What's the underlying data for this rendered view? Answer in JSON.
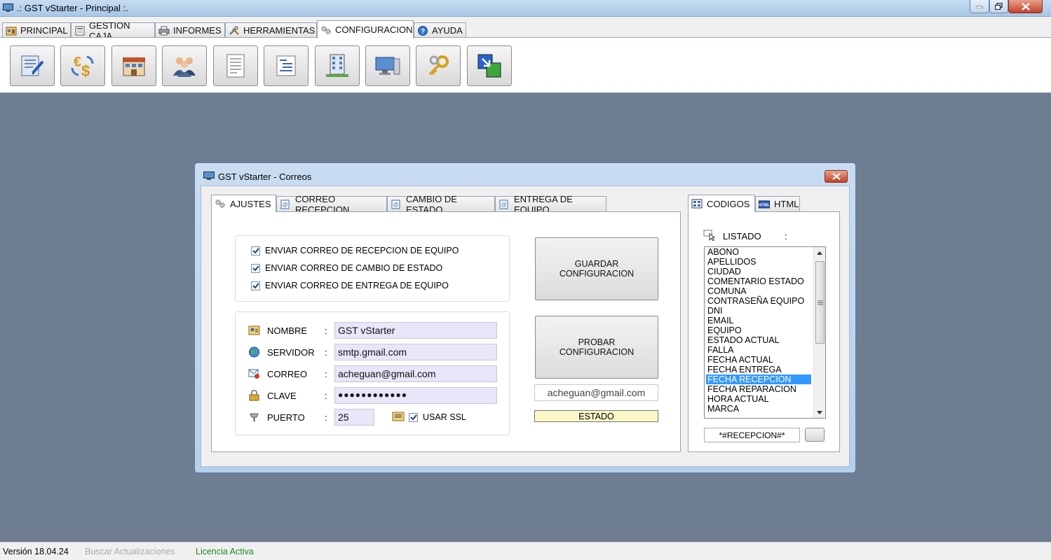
{
  "window": {
    "title": ".: GST vStarter - Principal :."
  },
  "main_tabs": [
    {
      "label": "PRINCIPAL",
      "icon": "home-icon"
    },
    {
      "label": "GESTION CAJA",
      "icon": "cash-register-icon"
    },
    {
      "label": "INFORMES",
      "icon": "printer-icon"
    },
    {
      "label": "HERRAMIENTAS",
      "icon": "tools-icon"
    },
    {
      "label": "CONFIGURACION",
      "icon": "gears-icon",
      "active": true
    },
    {
      "label": "AYUDA",
      "icon": "help-icon"
    }
  ],
  "toolbar": {
    "buttons": [
      {
        "icon": "edit-form-icon"
      },
      {
        "icon": "currency-exchange-icon"
      },
      {
        "icon": "store-icon"
      },
      {
        "icon": "users-icon"
      },
      {
        "icon": "document-icon"
      },
      {
        "icon": "text-list-icon"
      },
      {
        "icon": "building-icon"
      },
      {
        "icon": "computer-icon"
      },
      {
        "icon": "keys-icon"
      },
      {
        "icon": "shortcut-icon"
      }
    ]
  },
  "dialog": {
    "title": "GST vStarter - Correos",
    "tabs": [
      {
        "label": "AJUSTES",
        "active": true
      },
      {
        "label": "CORREO RECEPCION"
      },
      {
        "label": "CAMBIO DE ESTADO"
      },
      {
        "label": "ENTREGA DE EQUIPO"
      }
    ],
    "checkboxes": [
      {
        "label": "ENVIAR CORREO DE RECEPCION DE EQUIPO",
        "checked": true
      },
      {
        "label": "ENVIAR CORREO DE CAMBIO DE ESTADO",
        "checked": true
      },
      {
        "label": "ENVIAR CORREO DE ENTREGA DE EQUIPO",
        "checked": true
      }
    ],
    "fields": {
      "nombre": {
        "label": "NOMBRE",
        "value": "GST vStarter"
      },
      "servidor": {
        "label": "SERVIDOR",
        "value": "smtp.gmail.com"
      },
      "correo": {
        "label": "CORREO",
        "value": "acheguan@gmail.com"
      },
      "clave": {
        "label": "CLAVE",
        "value": "●●●●●●●●●●●●"
      },
      "puerto": {
        "label": "PUERTO",
        "value": "25"
      },
      "colon": ":"
    },
    "ssl": {
      "label": "USAR SSL",
      "checked": true
    },
    "buttons": {
      "guardar": "GUARDAR\nCONFIGURACION",
      "probar": "PROBAR\nCONFIGURACION"
    },
    "test_email": "acheguan@gmail.com",
    "estado": "ESTADO",
    "right_tabs": [
      {
        "label": "CODIGOS",
        "active": true
      },
      {
        "label": "HTML"
      }
    ],
    "listado": {
      "label": "LISTADO",
      "colon": ":"
    },
    "codes": [
      "ABONO",
      "APELLIDOS",
      "CIUDAD",
      "COMENTARIO ESTADO",
      "COMUNA",
      "CONTRASEÑA EQUIPO",
      "DNI",
      "EMAIL",
      "EQUIPO",
      "ESTADO ACTUAL",
      "FALLA",
      "FECHA ACTUAL",
      "FECHA ENTREGA",
      "FECHA RECEPCION",
      "FECHA REPARACION",
      "HORA ACTUAL",
      "MARCA"
    ],
    "selected_code": "FECHA RECEPCION",
    "code_value": "*#RECEPCION#*"
  },
  "statusbar": {
    "version": "Versión 18.04.24",
    "updates": "Buscar Actualizaciones",
    "license": "Licencia Activa"
  },
  "colors": {
    "desktop": "#6f7d92",
    "selection": "#3399ff",
    "input_bg": "#e8e6f8",
    "estado_bg": "#fbf8c8",
    "license": "#1a8a1a",
    "updates": "#a9a9a9"
  }
}
